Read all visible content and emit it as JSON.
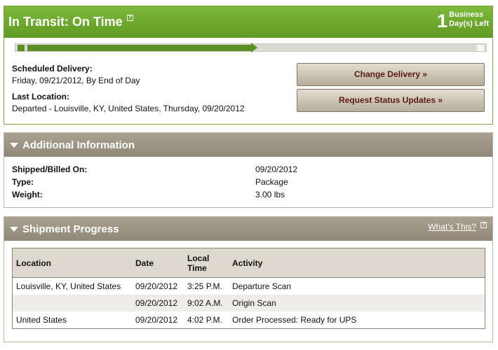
{
  "status": {
    "title": "In Transit: On Time",
    "help_icon": "question-icon",
    "days_left_number": "1",
    "days_left_line1": "Business",
    "days_left_line2": "Day(s) Left",
    "progress_fraction": 0.5,
    "scheduled_delivery_label": "Scheduled Delivery:",
    "scheduled_delivery_value": "Friday, 09/21/2012, By End of Day",
    "last_location_label": "Last Location:",
    "last_location_value": "Departed - Louisville, KY, United States, Thursday, 09/20/2012",
    "change_delivery_button": "Change Delivery »",
    "request_updates_button": "Request Status Updates »"
  },
  "additional_info": {
    "title": "Additional Information",
    "rows": [
      {
        "label": "Shipped/Billed On:",
        "value": "09/20/2012"
      },
      {
        "label": "Type:",
        "value": "Package"
      },
      {
        "label": "Weight:",
        "value": "3.00 lbs"
      }
    ]
  },
  "shipment_progress": {
    "title": "Shipment Progress",
    "whats_this_link": "What's This?",
    "columns": {
      "location": "Location",
      "date": "Date",
      "local_time_1": "Local",
      "local_time_2": "Time",
      "activity": "Activity"
    },
    "rows": [
      {
        "location": "Louisville, KY, United States",
        "date": "09/20/2012",
        "time": "3:25 P.M.",
        "activity": "Departure Scan"
      },
      {
        "location": "",
        "date": "09/20/2012",
        "time": "9:02 A.M.",
        "activity": "Origin Scan"
      },
      {
        "location": "United States",
        "date": "09/20/2012",
        "time": "4:02 P.M.",
        "activity": "Order Processed: Ready for UPS"
      }
    ]
  },
  "colors": {
    "status_green": "#6aa62e",
    "section_tan": "#9e9484",
    "button_text": "#5a1a10"
  }
}
